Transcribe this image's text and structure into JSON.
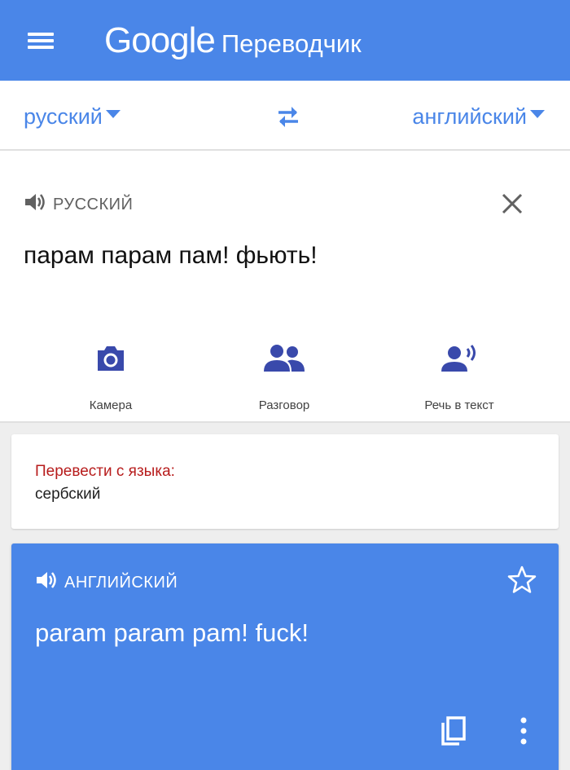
{
  "appbar": {
    "logo_text": "Google",
    "app_name": "Переводчик",
    "menu_icon": "hamburger-menu-icon"
  },
  "languages": {
    "source": "русский",
    "target": "английский",
    "swap_icon": "swap-arrows-icon"
  },
  "input": {
    "language_label": "РУССКИЙ",
    "text": "парам парам пам! фьють!",
    "tools": [
      {
        "label": "Камера",
        "icon": "camera-icon"
      },
      {
        "label": "Разговор",
        "icon": "people-icon"
      },
      {
        "label": "Речь в текст",
        "icon": "voice-person-icon"
      }
    ]
  },
  "detect": {
    "title": "Перевести с языка:",
    "language": "сербский"
  },
  "result": {
    "language_label": "АНГЛИЙСКИЙ",
    "text": "param param pam!  fuck!"
  },
  "colors": {
    "accent": "#4a86e8",
    "tool_icon": "#3949ab",
    "detect_title": "#b71c1c"
  }
}
